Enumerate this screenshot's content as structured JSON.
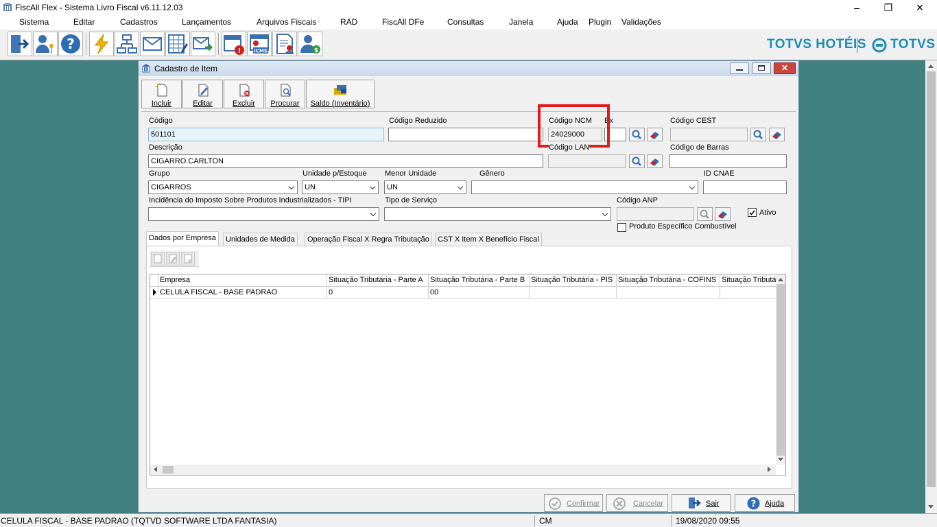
{
  "window": {
    "title": "FiscAll Flex - Sistema Livro Fiscal v6.11.12.03"
  },
  "menu": [
    "Sistema",
    "Editar",
    "Cadastros",
    "Lançamentos",
    "Arquivos Fiscais",
    "RAD",
    "FiscAll DFe",
    "Consultas",
    "Janela",
    "Ajuda",
    "Plugin",
    "Validações"
  ],
  "brand": {
    "hotels": "TOTVS HOTÉIS",
    "totvs": "TOTVS",
    "color": "#1c8db3"
  },
  "child": {
    "title": "Cadastro de Item",
    "buttons": {
      "incluir": "Incluir",
      "editar": "Editar",
      "excluir": "Excluir",
      "procurar": "Procurar",
      "saldo": "Saldo (Inventário)"
    },
    "labels": {
      "codigo": "Código",
      "codigo_reduzido": "Código Reduzido",
      "codigo_ncm": "Código NCM",
      "ex": "Ex",
      "codigo_cest": "Código CEST",
      "descricao": "Descrição",
      "codigo_lan": "Código LAN",
      "codigo_barras": "Código de Barras",
      "grupo": "Grupo",
      "unidade_estoque": "Unidade p/Estoque",
      "menor_unidade": "Menor Unidade",
      "genero": "Gênero",
      "id_cnae": "ID CNAE",
      "ipi": "Incidência do Imposto Sobre Produtos Industrializados - TIPI",
      "tipo_servico": "Tipo de Serviço",
      "codigo_anp": "Código ANP",
      "ativo": "Ativo",
      "combustivel": "Produto Específico Combustível"
    },
    "values": {
      "codigo": "501101",
      "codigo_ncm": "24029000",
      "descricao": "CIGARRO CARLTON",
      "grupo": "CIGARROS",
      "unidade_estoque": "UN",
      "menor_unidade": "UN"
    },
    "tabs": [
      "Dados por Empresa",
      "Unidades de Medida",
      "Operação Fiscal X Regra Tributação",
      "CST X Item X Benefício Fiscal"
    ],
    "grid": {
      "columns": [
        "Empresa",
        "Situação Tributária - Parte A",
        "Situação Tributária - Parte B",
        "Situação Tributária - PIS",
        "Situação Tributária - COFINS",
        "Situação Tributária"
      ],
      "rows": [
        [
          "CELULA FISCAL - BASE PADRAO",
          "0",
          "00",
          "",
          "",
          ""
        ]
      ]
    },
    "footer": {
      "confirmar": "Confirmar",
      "cancelar": "Cancelar",
      "sair": "Sair",
      "ajuda": "Ajuda"
    }
  },
  "status": {
    "company": "CELULA FISCAL - BASE PADRAO (TQTVD SOFTWARE LTDA FANTASIA)",
    "mode": "CM",
    "datetime": "19/08/2020 09:55"
  },
  "highlight_color": "#e01b1b"
}
